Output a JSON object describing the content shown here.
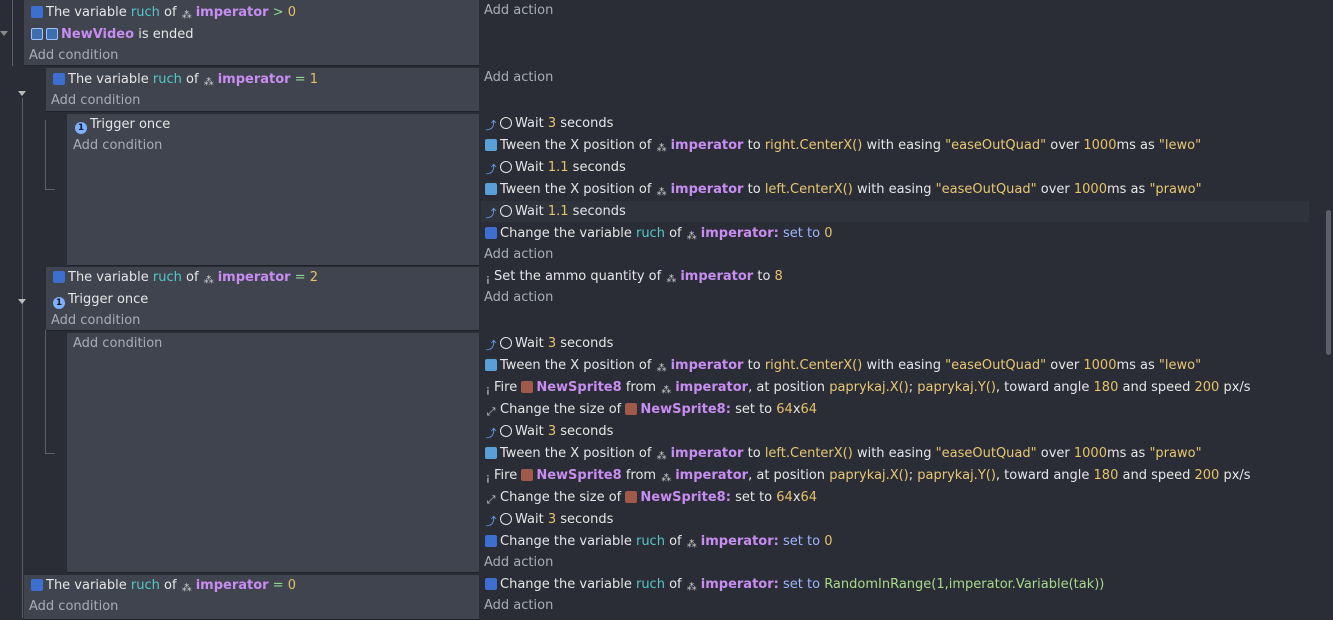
{
  "icons": {
    "variable": "variable-icon",
    "video": "video-icon",
    "trigger": "trigger-once-icon",
    "object": "object-icon",
    "timer": "timer-icon",
    "tween": "tween-icon",
    "sprite": "sprite-icon",
    "resize": "resize-icon",
    "info": "info-icon",
    "wait": "wait-icon"
  },
  "colors": {
    "object": "#c78df0",
    "variable": "#54c7c7",
    "number": "#e6c16a",
    "string": "#e8c774",
    "background": "#2a2d35",
    "condition_panel": "#40444f"
  },
  "labels": {
    "add_action": "Add action",
    "add_condition": "Add condition",
    "the_variable": "The variable",
    "of": "of",
    "trigger_once": "Trigger once",
    "is_ended": "is ended",
    "wait": "Wait",
    "seconds": "seconds",
    "tween_x": "Tween the X position of",
    "to": "to",
    "with_easing": "with easing",
    "over": "over",
    "ms_as": "ms as",
    "change_variable": "Change the variable",
    "set_to": "set to",
    "set_ammo": "Set the ammo quantity of",
    "fire": "Fire",
    "from": "from",
    "at_position": ", at position",
    "toward_angle": ", toward angle",
    "and_speed": "and speed",
    "px_s": "px/s",
    "change_size": "Change the size of",
    "x": "x",
    "semicolon": ";"
  },
  "names": {
    "var_ruch": "ruch",
    "obj_imperator": "imperator",
    "obj_newvideo": "NewVideo",
    "obj_newsprite8": "NewSprite8",
    "colon": ":"
  },
  "values": {
    "gt": ">",
    "eq": "=",
    "v0": "0",
    "v1": "1",
    "v2": "2",
    "v3": "3",
    "v8": "8",
    "v1_1": "1.1",
    "v1000": "1000",
    "v64": "64",
    "v180": "180",
    "v200": "200",
    "ease": "\"easeOutQuad\"",
    "lewo": "\"lewo\"",
    "prawo": "\"prawo\"",
    "right_center": "right.CenterX()",
    "left_center": "left.CenterX()",
    "paprykaj_x": "paprykaj.X()",
    "paprykaj_y": "paprykaj.Y()",
    "random_expr": "RandomInRange(1,imperator.Variable(tak))"
  }
}
